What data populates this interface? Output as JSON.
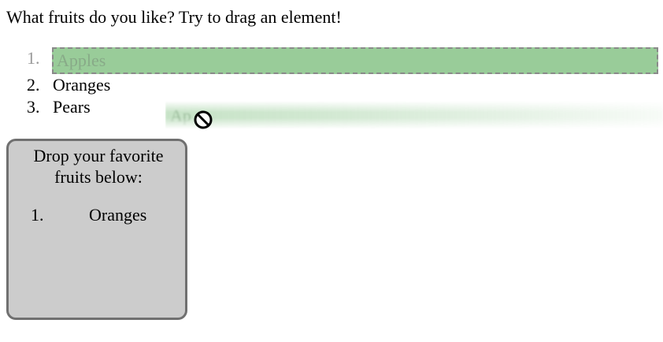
{
  "question": "What fruits do you like? Try to drag an element!",
  "fruits": [
    {
      "num": "1.",
      "label": "Apples"
    },
    {
      "num": "2.",
      "label": "Oranges"
    },
    {
      "num": "3.",
      "label": "Pears"
    }
  ],
  "drag_ghost": {
    "label": "Ap"
  },
  "drop_zone": {
    "title": "Drop your favorite fruits below:",
    "items": [
      {
        "num": "1.",
        "label": "Oranges"
      }
    ]
  },
  "icons": {
    "cursor": "no-drop-cursor-icon"
  },
  "colors": {
    "dragging_fill": "#99cc99",
    "dragging_border": "#8a8a8a",
    "drop_zone_bg": "#cccccc",
    "drop_zone_border": "#707070"
  }
}
